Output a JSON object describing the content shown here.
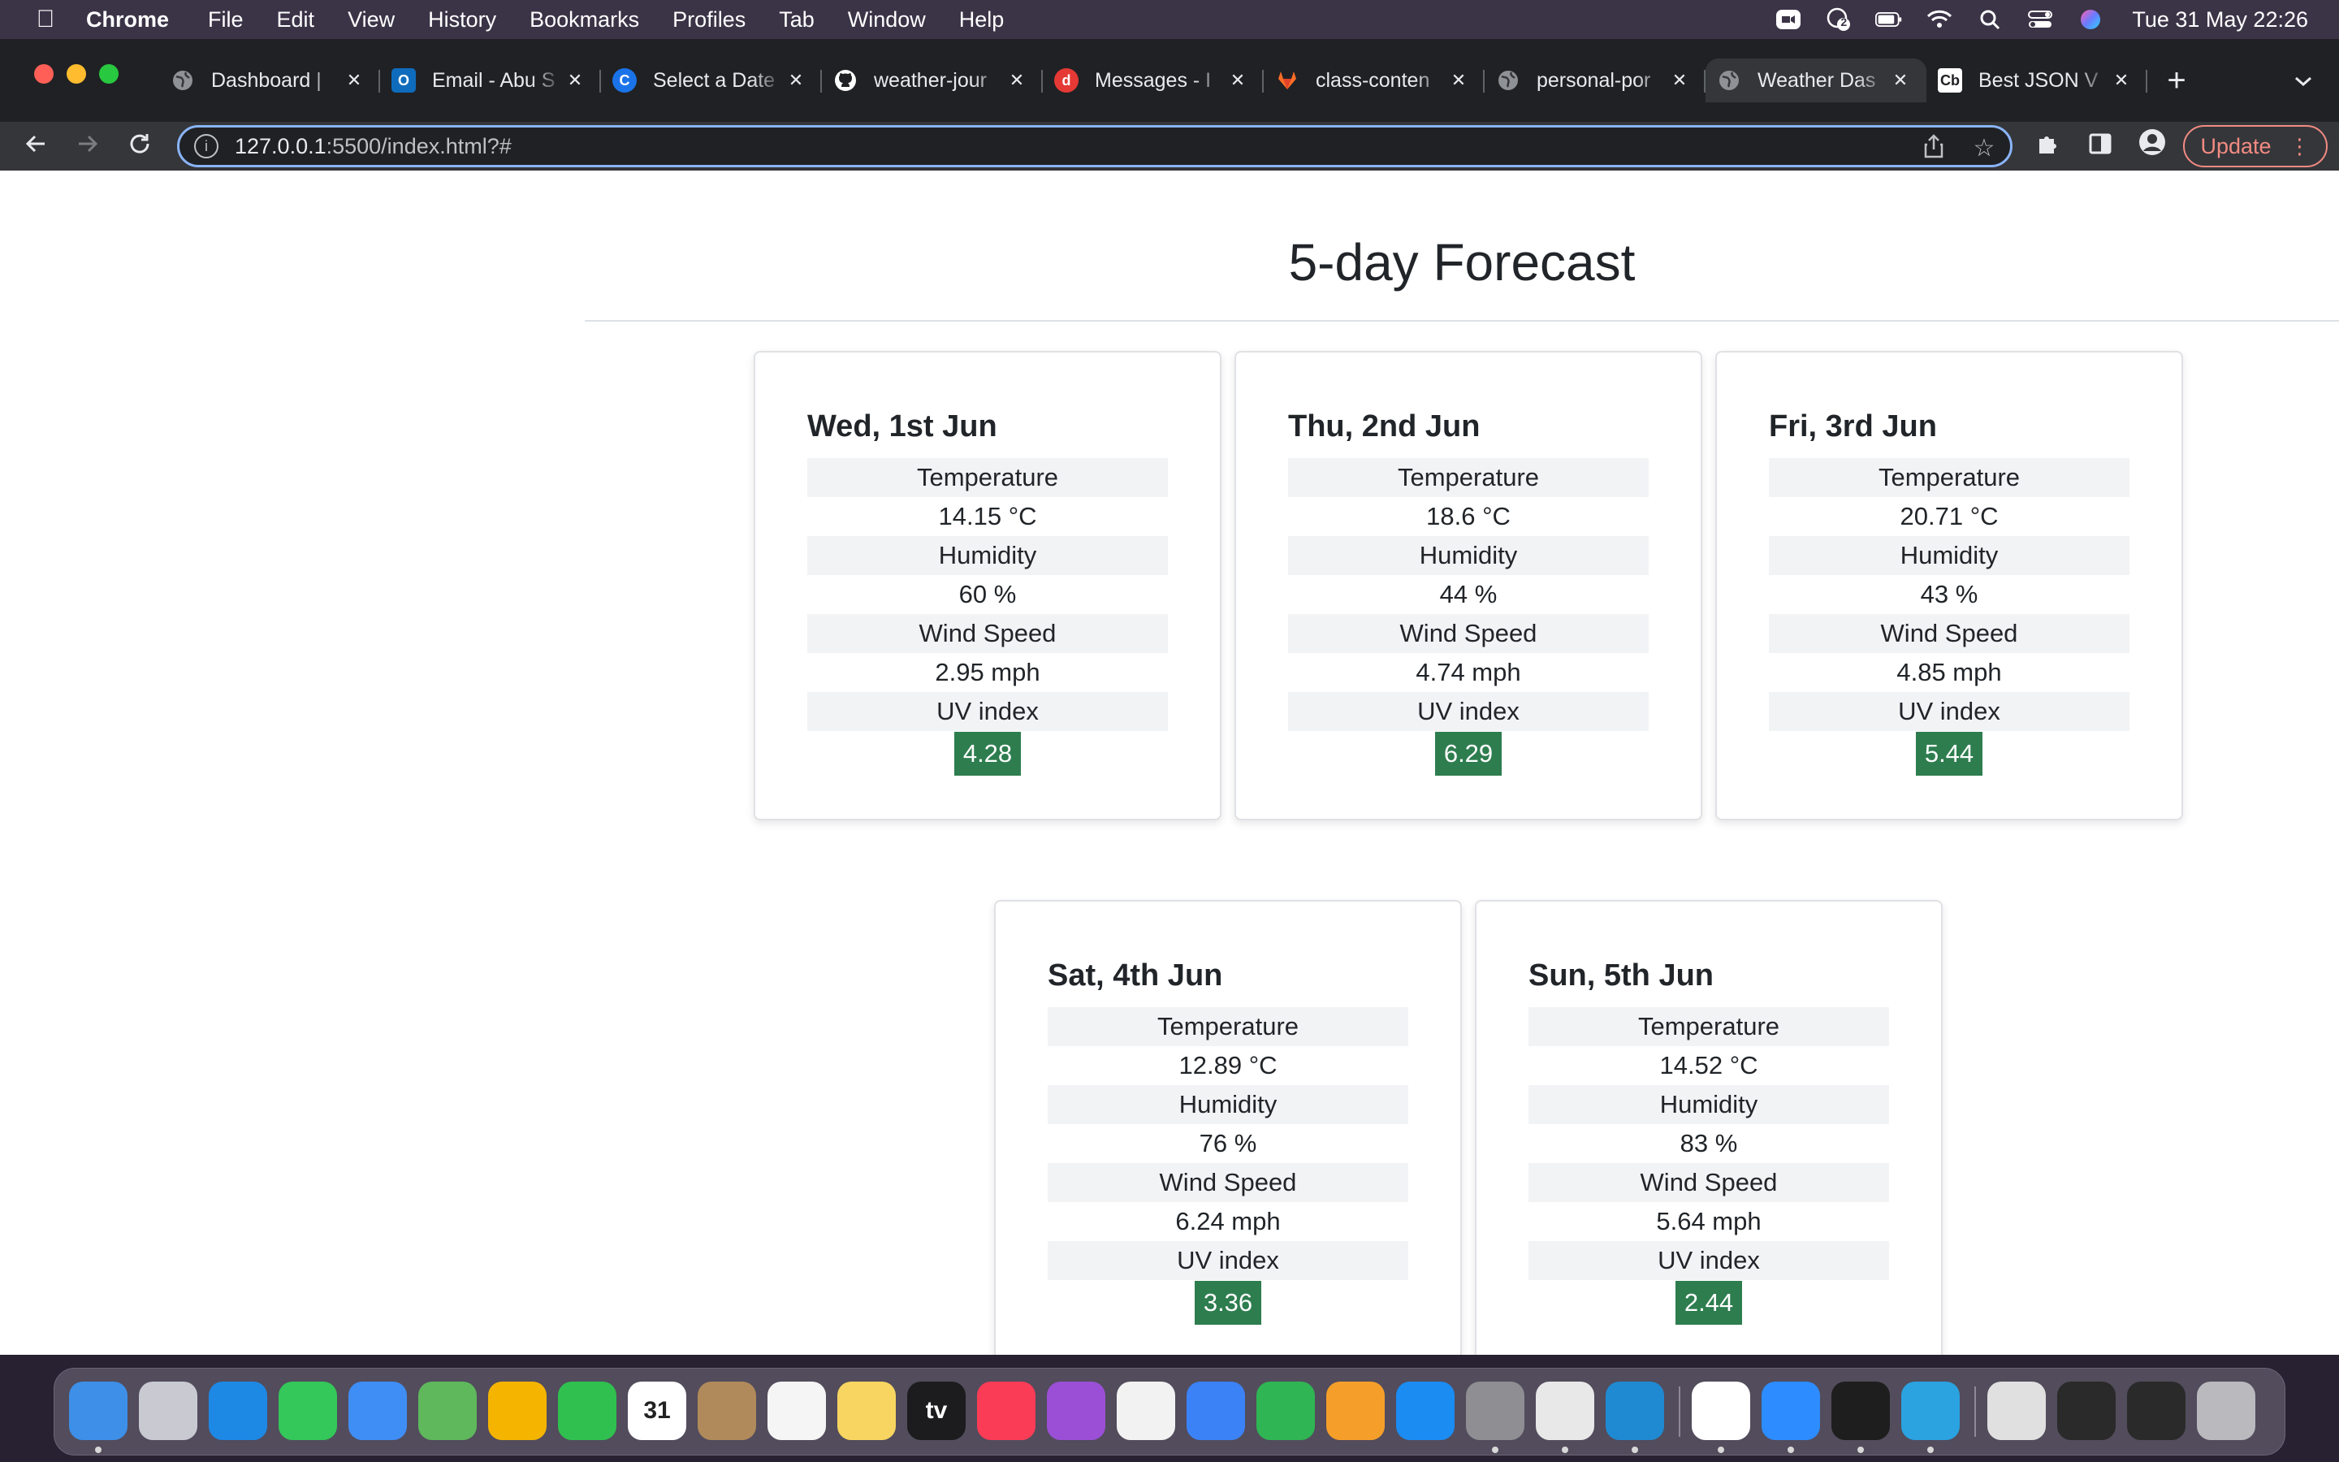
{
  "menubar": {
    "app_name": "Chrome",
    "items": [
      "File",
      "Edit",
      "View",
      "History",
      "Bookmarks",
      "Profiles",
      "Tab",
      "Window",
      "Help"
    ],
    "clock": "Tue 31 May  22:26",
    "status_badge": "2"
  },
  "browser": {
    "tabs": [
      {
        "title": "Dashboard |",
        "favicon": "globe-icon",
        "color": "#5f6368",
        "glyph": ""
      },
      {
        "title": "Email - Abu S",
        "favicon": "outlook-icon",
        "color": "#0f6cbd",
        "glyph": "O"
      },
      {
        "title": "Select a Date",
        "favicon": "calendly-icon",
        "color": "#1a73e8",
        "glyph": "C"
      },
      {
        "title": "weather-jour",
        "favicon": "github-icon",
        "color": "#ffffff",
        "glyph": ""
      },
      {
        "title": "Messages - I",
        "favicon": "messages-icon",
        "color": "#e53935",
        "glyph": "d"
      },
      {
        "title": "class-conten",
        "favicon": "gitlab-icon",
        "color": "#fc6d26",
        "glyph": ""
      },
      {
        "title": "personal-por",
        "favicon": "globe-icon",
        "color": "#5f6368",
        "glyph": ""
      },
      {
        "title": "Weather Das",
        "favicon": "globe-icon",
        "color": "#5f6368",
        "glyph": "",
        "active": true
      },
      {
        "title": "Best JSON V",
        "favicon": "codebeautify-icon",
        "color": "#ffffff",
        "glyph": "Cb"
      }
    ],
    "address_host": "127.0.0.1",
    "address_rest": ":5500/index.html?#",
    "update_label": "Update"
  },
  "page": {
    "title": "5-day Forecast",
    "labels": {
      "temperature": "Temperature",
      "humidity": "Humidity",
      "wind": "Wind Speed",
      "uv": "UV index"
    },
    "forecast": [
      {
        "day": "Wed, 1st Jun",
        "temperature": "14.15 °C",
        "humidity": "60 %",
        "wind": "2.95 mph",
        "uv": "4.28"
      },
      {
        "day": "Thu, 2nd Jun",
        "temperature": "18.6 °C",
        "humidity": "44 %",
        "wind": "4.74 mph",
        "uv": "6.29"
      },
      {
        "day": "Fri, 3rd Jun",
        "temperature": "20.71 °C",
        "humidity": "43 %",
        "wind": "4.85 mph",
        "uv": "5.44"
      },
      {
        "day": "Sat, 4th Jun",
        "temperature": "12.89 °C",
        "humidity": "76 %",
        "wind": "6.24 mph",
        "uv": "3.36"
      },
      {
        "day": "Sun, 5th Jun",
        "temperature": "14.52 °C",
        "humidity": "83 %",
        "wind": "5.64 mph",
        "uv": "2.44"
      }
    ]
  },
  "dock": {
    "apps": [
      {
        "name": "finder-icon",
        "color": "#3d8fe8",
        "running": true
      },
      {
        "name": "launchpad-icon",
        "color": "#c9c9d1",
        "running": false
      },
      {
        "name": "safari-icon",
        "color": "#1e88e5",
        "running": false
      },
      {
        "name": "messages-app-icon",
        "color": "#34c759",
        "running": false
      },
      {
        "name": "mail-icon",
        "color": "#3f8ef5",
        "running": false
      },
      {
        "name": "maps-icon",
        "color": "#5fb85c",
        "running": false
      },
      {
        "name": "photos-icon",
        "color": "#f4b400",
        "running": false
      },
      {
        "name": "facetime-icon",
        "color": "#30c04f",
        "running": false
      },
      {
        "name": "calendar-icon",
        "color": "#ffffff",
        "running": false,
        "text_color": "#222222",
        "glyph": "31"
      },
      {
        "name": "contacts-icon",
        "color": "#b08a5a",
        "running": false
      },
      {
        "name": "reminders-icon",
        "color": "#f5f5f5",
        "running": false
      },
      {
        "name": "notes-icon",
        "color": "#f7d560",
        "running": false
      },
      {
        "name": "tv-icon",
        "color": "#1c1c1e",
        "running": false,
        "glyph": "tv"
      },
      {
        "name": "music-icon",
        "color": "#fa3c56",
        "running": false
      },
      {
        "name": "podcasts-icon",
        "color": "#9b4fd6",
        "running": false
      },
      {
        "name": "news-icon",
        "color": "#f2f2f2",
        "running": false
      },
      {
        "name": "keynote-icon",
        "color": "#3b82f6",
        "running": false
      },
      {
        "name": "numbers-icon",
        "color": "#2fb553",
        "running": false
      },
      {
        "name": "pages-icon",
        "color": "#f59f2a",
        "running": false
      },
      {
        "name": "app-store-icon",
        "color": "#1b8cf2",
        "running": false
      },
      {
        "name": "system-preferences-icon",
        "color": "#8e8e93",
        "running": true
      },
      {
        "name": "chrome-icon",
        "color": "#e8e8e8",
        "running": true
      },
      {
        "name": "vscode-icon",
        "color": "#1f8ad2",
        "running": true
      },
      {
        "name": "slack-icon",
        "color": "#ffffff",
        "running": true
      },
      {
        "name": "zoom-icon",
        "color": "#2d8cff",
        "running": true
      },
      {
        "name": "terminal-icon",
        "color": "#1e1e1e",
        "running": true
      },
      {
        "name": "telegram-icon",
        "color": "#2aa3e0",
        "running": true
      },
      {
        "name": "document-icon",
        "color": "#e0e0e0",
        "running": false
      },
      {
        "name": "window-thumbnail-icon",
        "color": "#2a2a2a",
        "running": false
      },
      {
        "name": "window-thumbnail-icon",
        "color": "#2a2a2a",
        "running": false
      },
      {
        "name": "trash-icon",
        "color": "#b9b9be",
        "running": false
      }
    ]
  }
}
